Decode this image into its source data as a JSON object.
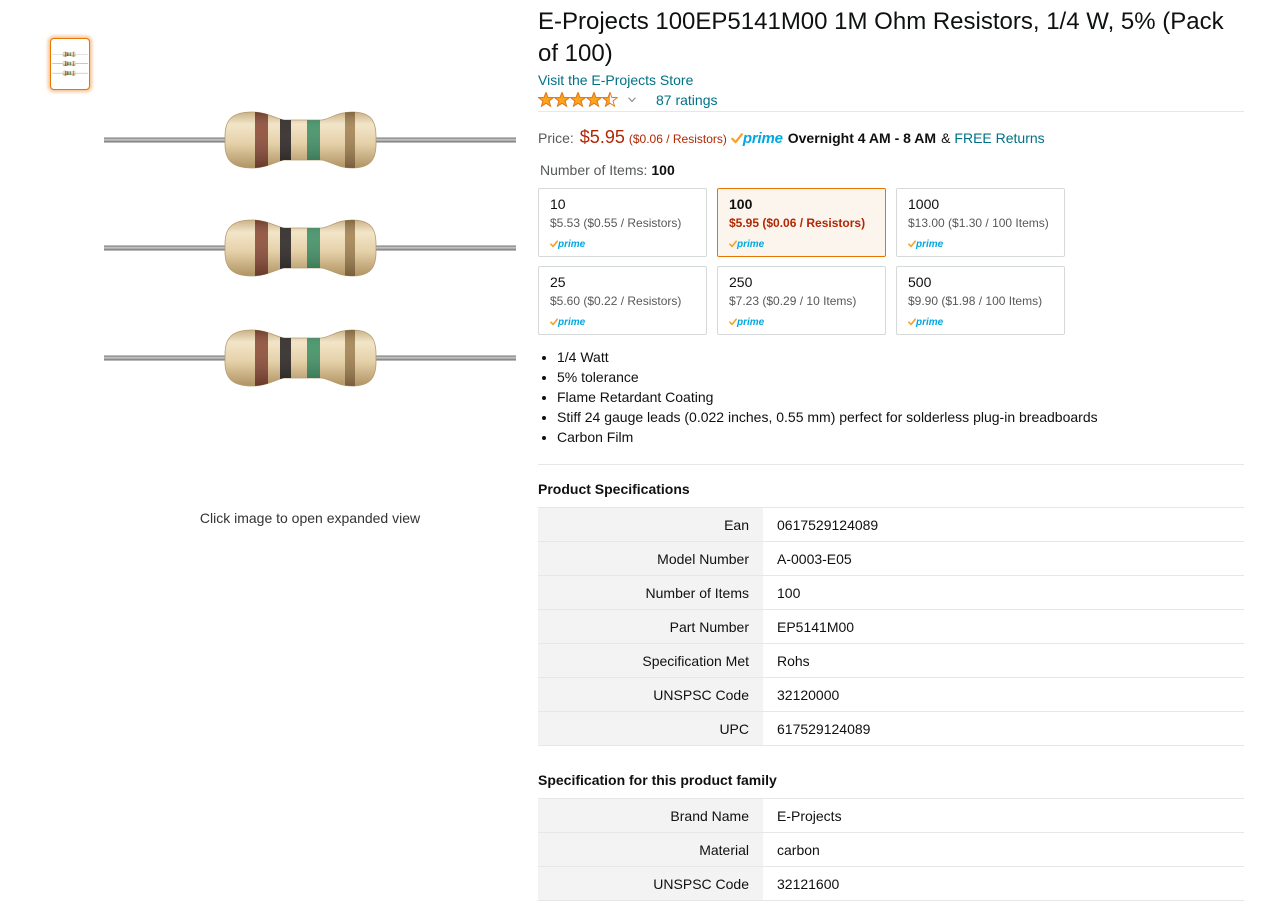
{
  "colors": {
    "text": "#0F1111",
    "link": "#007185",
    "price": "#B12704",
    "secondary": "#565959",
    "selected_border": "#E77600",
    "selected_bg": "#FCF5EE",
    "option_border": "#D5D9D9",
    "divider": "#E7E7E7",
    "table_label_bg": "#F3F3F3",
    "star_fill": "#FFA41C",
    "star_stroke": "#DE7921",
    "prime_blue": "#00A8E1",
    "prime_check": "#F7A02A"
  },
  "icons": {
    "rating": "star-icon",
    "rating_dropdown": "chevron-down-icon",
    "prime_check": "check-icon"
  },
  "gallery": {
    "caption": "Click image to open expanded view"
  },
  "product": {
    "title": "E-Projects 100EP5141M00 1M Ohm Resistors, 1/4 W, 5% (Pack of 100)",
    "store_link": "Visit the E-Projects Store"
  },
  "rating": {
    "stars": 4.5,
    "count_label": "87 ratings"
  },
  "price": {
    "label": "Price:",
    "amount": "$5.95",
    "per_unit": "($0.06 / Resistors)",
    "delivery": "Overnight 4 AM - 8 AM",
    "connector": "&",
    "returns_link": "FREE Returns"
  },
  "prime_logo": "prime",
  "number_of_items": {
    "label": "Number of Items:",
    "value": "100"
  },
  "options": [
    {
      "quantity": "10",
      "price_line": "$5.53 ($0.55 / Resistors)",
      "selected": false
    },
    {
      "quantity": "100",
      "price_line": "$5.95 ($0.06 / Resistors)",
      "selected": true
    },
    {
      "quantity": "1000",
      "price_line": "$13.00 ($1.30 / 100 Items)",
      "selected": false
    },
    {
      "quantity": "25",
      "price_line": "$5.60 ($0.22 / Resistors)",
      "selected": false
    },
    {
      "quantity": "250",
      "price_line": "$7.23 ($0.29 / 10 Items)",
      "selected": false
    },
    {
      "quantity": "500",
      "price_line": "$9.90 ($1.98 / 100 Items)",
      "selected": false
    }
  ],
  "features": [
    "1/4 Watt",
    "5% tolerance",
    "Flame Retardant Coating",
    "Stiff 24 gauge leads (0.022 inches, 0.55 mm) perfect for solderless plug-in breadboards",
    "Carbon Film"
  ],
  "product_specifications": {
    "heading": "Product Specifications",
    "rows": [
      {
        "label": "Ean",
        "value": "0617529124089"
      },
      {
        "label": "Model Number",
        "value": "A-0003-E05"
      },
      {
        "label": "Number of Items",
        "value": "100"
      },
      {
        "label": "Part Number",
        "value": "EP5141M00"
      },
      {
        "label": "Specification Met",
        "value": "Rohs"
      },
      {
        "label": "UNSPSC Code",
        "value": "32120000"
      },
      {
        "label": "UPC",
        "value": "617529124089"
      }
    ]
  },
  "family_specifications": {
    "heading": "Specification for this product family",
    "rows": [
      {
        "label": "Brand Name",
        "value": "E-Projects"
      },
      {
        "label": "Material",
        "value": "carbon"
      },
      {
        "label": "UNSPSC Code",
        "value": "32121600"
      }
    ]
  }
}
